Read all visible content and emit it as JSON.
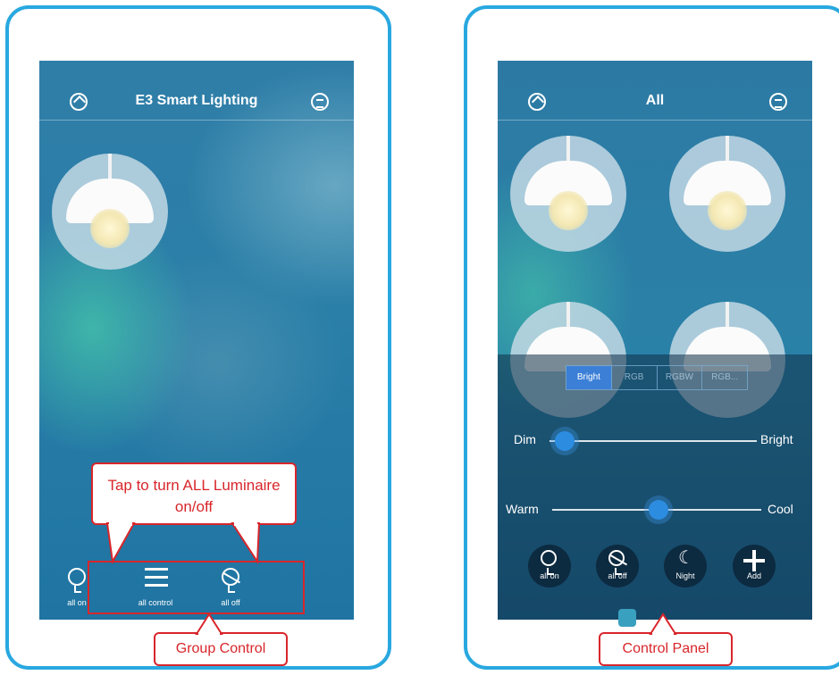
{
  "left_screen": {
    "title": "E3 Smart Lighting",
    "bottom_bar": {
      "all_on": "all on",
      "all_control": "all control",
      "all_off": "all off"
    },
    "callout_top": "Tap to turn ALL Luminaire on/off",
    "callout_bottom": "Group Control"
  },
  "right_screen": {
    "title": "All",
    "tabs": [
      "Bright",
      "RGB",
      "RGBW",
      "RGB..."
    ],
    "active_tab": "Bright",
    "slider_brightness": {
      "left_label": "Dim",
      "right_label": "Bright",
      "value": 0.08
    },
    "slider_temperature": {
      "left_label": "Warm",
      "right_label": "Cool",
      "value": 0.5
    },
    "buttons": {
      "all_on": "all on",
      "all_off": "all off",
      "night": "Night",
      "add": "Add"
    },
    "callout": "Control Panel"
  },
  "colors": {
    "frame": "#29a8e0",
    "callout_red": "#d8262b",
    "active_tab": "#3b7fd6"
  },
  "icons": [
    "home-icon",
    "menu-icon",
    "bulb-on-icon",
    "bulb-off-icon",
    "sliders-icon",
    "moon-icon",
    "plus-icon"
  ]
}
